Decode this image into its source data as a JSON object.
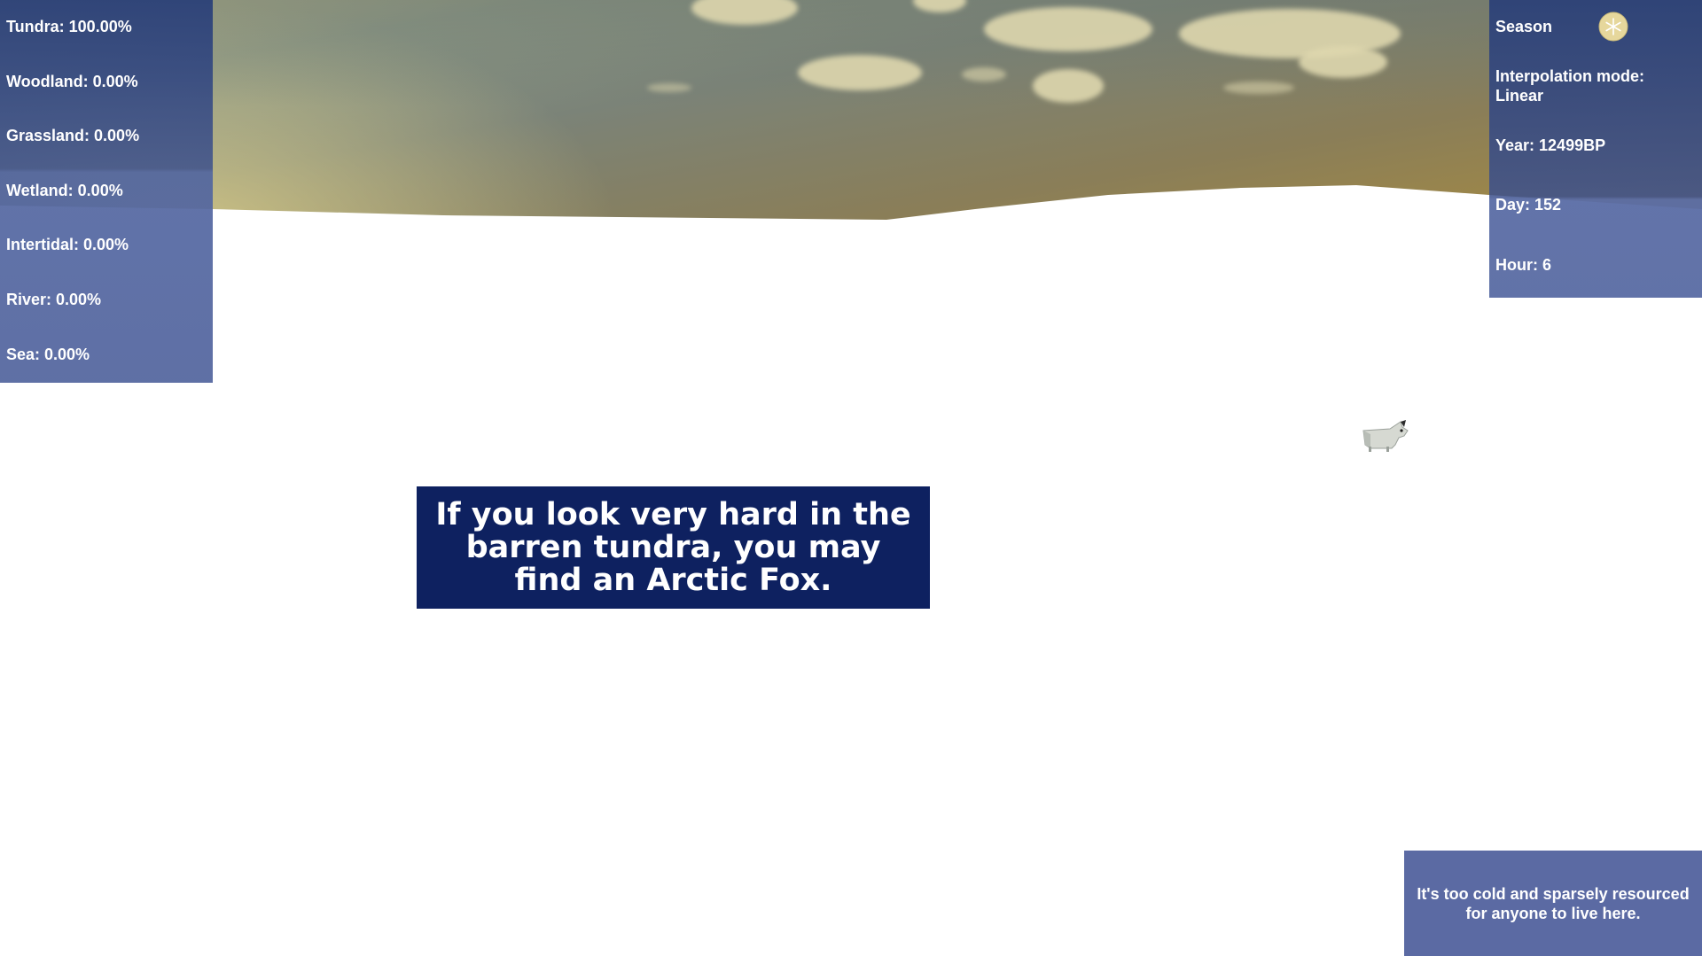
{
  "biomes": {
    "tundra": "Tundra: 100.00%",
    "woodland": "Woodland: 0.00%",
    "grassland": "Grassland: 0.00%",
    "wetland": "Wetland: 0.00%",
    "intertidal": "Intertidal: 0.00%",
    "river": "River: 0.00%",
    "sea": "Sea: 0.00%"
  },
  "time_panel": {
    "season_label": "Season",
    "season_icon": "snowflake-moon-icon",
    "interpolation": "Interpolation mode: Linear",
    "year": "Year: 12499BP",
    "day": "Day: 152",
    "hour": "Hour: 6"
  },
  "fact_text": "If you look very hard in the barren tundra, you may find an Arctic Fox.",
  "message_text": "It's too cold and sparsely resourced for anyone to live here.",
  "colors": {
    "panel_blue": "#3c5090",
    "fact_box": "#0e2160",
    "message_box": "#5b6aa3",
    "snow": "#ffffff"
  }
}
